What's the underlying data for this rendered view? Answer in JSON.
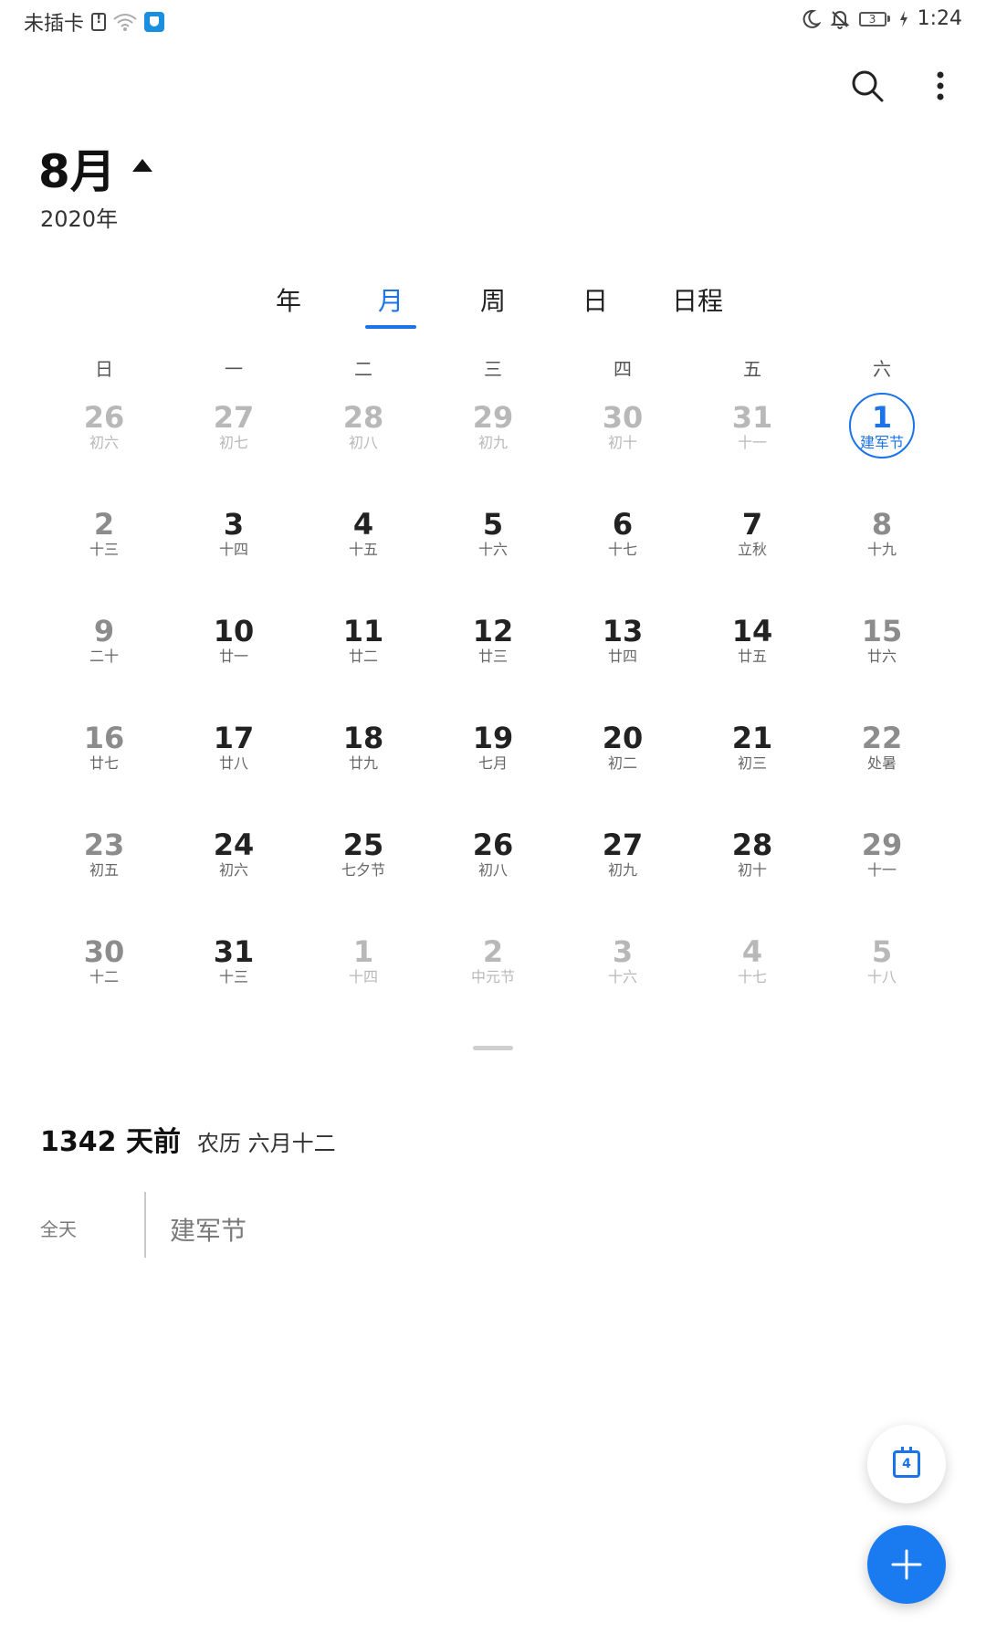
{
  "status_bar": {
    "carrier": "未插卡",
    "time": "1:24",
    "battery_level": "3"
  },
  "header": {
    "month": "8月",
    "year": "2020年"
  },
  "tabs": [
    {
      "label": "年",
      "active": false
    },
    {
      "label": "月",
      "active": true
    },
    {
      "label": "周",
      "active": false
    },
    {
      "label": "日",
      "active": false
    },
    {
      "label": "日程",
      "active": false
    }
  ],
  "weekdays": [
    "日",
    "一",
    "二",
    "三",
    "四",
    "五",
    "六"
  ],
  "calendar": {
    "weeks": [
      [
        {
          "day": "26",
          "lunar": "初六",
          "muted": true
        },
        {
          "day": "27",
          "lunar": "初七",
          "muted": true
        },
        {
          "day": "28",
          "lunar": "初八",
          "muted": true
        },
        {
          "day": "29",
          "lunar": "初九",
          "muted": true
        },
        {
          "day": "30",
          "lunar": "初十",
          "muted": true
        },
        {
          "day": "31",
          "lunar": "十一",
          "muted": true
        },
        {
          "day": "1",
          "lunar": "建军节",
          "selected": true
        }
      ],
      [
        {
          "day": "2",
          "lunar": "十三"
        },
        {
          "day": "3",
          "lunar": "十四"
        },
        {
          "day": "4",
          "lunar": "十五"
        },
        {
          "day": "5",
          "lunar": "十六"
        },
        {
          "day": "6",
          "lunar": "十七"
        },
        {
          "day": "7",
          "lunar": "立秋"
        },
        {
          "day": "8",
          "lunar": "十九"
        }
      ],
      [
        {
          "day": "9",
          "lunar": "二十"
        },
        {
          "day": "10",
          "lunar": "廿一"
        },
        {
          "day": "11",
          "lunar": "廿二"
        },
        {
          "day": "12",
          "lunar": "廿三"
        },
        {
          "day": "13",
          "lunar": "廿四"
        },
        {
          "day": "14",
          "lunar": "廿五"
        },
        {
          "day": "15",
          "lunar": "廿六"
        }
      ],
      [
        {
          "day": "16",
          "lunar": "廿七"
        },
        {
          "day": "17",
          "lunar": "廿八"
        },
        {
          "day": "18",
          "lunar": "廿九"
        },
        {
          "day": "19",
          "lunar": "七月"
        },
        {
          "day": "20",
          "lunar": "初二"
        },
        {
          "day": "21",
          "lunar": "初三"
        },
        {
          "day": "22",
          "lunar": "处暑"
        }
      ],
      [
        {
          "day": "23",
          "lunar": "初五"
        },
        {
          "day": "24",
          "lunar": "初六"
        },
        {
          "day": "25",
          "lunar": "七夕节"
        },
        {
          "day": "26",
          "lunar": "初八"
        },
        {
          "day": "27",
          "lunar": "初九"
        },
        {
          "day": "28",
          "lunar": "初十"
        },
        {
          "day": "29",
          "lunar": "十一"
        }
      ],
      [
        {
          "day": "30",
          "lunar": "十二"
        },
        {
          "day": "31",
          "lunar": "十三"
        },
        {
          "day": "1",
          "lunar": "十四",
          "muted": true
        },
        {
          "day": "2",
          "lunar": "中元节",
          "muted": true
        },
        {
          "day": "3",
          "lunar": "十六",
          "muted": true
        },
        {
          "day": "4",
          "lunar": "十七",
          "muted": true
        },
        {
          "day": "5",
          "lunar": "十八",
          "muted": true
        }
      ]
    ]
  },
  "info": {
    "days_ago": "1342 天前",
    "lunar_date": "农历 六月十二"
  },
  "event": {
    "time": "全天",
    "title": "建军节"
  },
  "today_button": {
    "day": "4"
  },
  "colors": {
    "accent": "#1a73e8",
    "fab": "#1a7af0"
  }
}
